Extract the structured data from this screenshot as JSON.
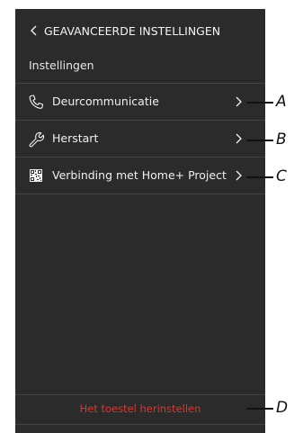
{
  "header": {
    "title": "GEAVANCEERDE INSTELLINGEN",
    "back_icon": "chevron-left"
  },
  "section": {
    "label": "Instellingen"
  },
  "menu": {
    "items": [
      {
        "label": "Deurcommunicatie",
        "icon": "phone-icon"
      },
      {
        "label": "Herstart",
        "icon": "wrench-icon"
      },
      {
        "label": "Verbinding met Home+ Project",
        "icon": "qr-code-icon"
      }
    ],
    "chevron_icon": "chevron-right"
  },
  "footer": {
    "reset_label": "Het toestel herinstellen",
    "reset_color": "#d23a35"
  },
  "callouts": {
    "a": "A",
    "b": "B",
    "c": "C",
    "d": "D"
  },
  "colors": {
    "background": "#2b2b2b",
    "text": "#f2f2f2",
    "divider": "#454545"
  }
}
